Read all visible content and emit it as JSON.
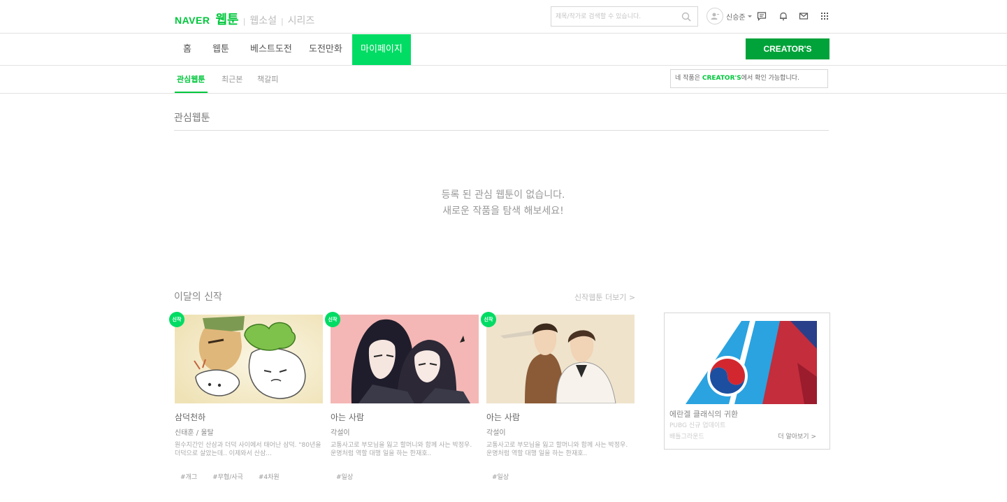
{
  "header": {
    "logo_naver": "NAVER",
    "logo_webtoon": "웹툰",
    "sub_services": [
      "웹소설",
      "시리즈"
    ],
    "search_placeholder": "제목/작가로 검색할 수 있습니다.",
    "user_name": "신승준"
  },
  "nav": {
    "items": [
      "홈",
      "웹툰",
      "베스트도전",
      "도전만화",
      "마이페이지"
    ],
    "active": "마이페이지",
    "creators_button": "CREATOR'S"
  },
  "subnav": {
    "items": [
      "관심웹툰",
      "최근본",
      "책갈피"
    ],
    "active": "관심웹툰",
    "notice_prefix": "네 작품은 ",
    "notice_highlight": "CREATOR'S",
    "notice_suffix": "에서 확인 가능합니다."
  },
  "favorites": {
    "title": "관심웹툰",
    "empty_line1": "등록 된 관심 웹툰이 없습니다.",
    "empty_line2": "새로운 작품을 탐색 해보세요!"
  },
  "new_series": {
    "title": "이달의 신작",
    "more_link": "신작웹툰 더보기 >",
    "badge": "신작",
    "cards": [
      {
        "title": "삼덕천하",
        "author": "신태훈 / 울탈",
        "desc": "원수지간인 산삼과 더덕 사이에서 태어난 삼덕. \"80년을 더덕으로 살았는데.. 이제와서 산삼...",
        "tags": [
          "#개그",
          "#무협/사극",
          "#4차원"
        ]
      },
      {
        "title": "아는 사람",
        "author": "각설이",
        "desc": "교통사고로 부모님을 잃고 할머니와 함께 사는 박정우. 운명처럼 역할 대행 일을 하는 한재호..",
        "tags": [
          "#일상"
        ]
      },
      {
        "title": "아는 사람",
        "author": "각설이",
        "desc": "교통사고로 부모님을 잃고 할머니와 함께 사는 박정우. 운명처럼 역할 대행 일을 하는 한재호..",
        "tags": [
          "#일상"
        ]
      }
    ]
  },
  "ad": {
    "title": "에란겔 클래식의 귀환",
    "subtitle": "PUBG 신규 업데이트",
    "source": "배틀그라운드",
    "more": "더 알아보기 >"
  },
  "colors": {
    "brand_green": "#00c73c",
    "nav_active": "#00dc64",
    "creators_button": "#00a33a"
  }
}
